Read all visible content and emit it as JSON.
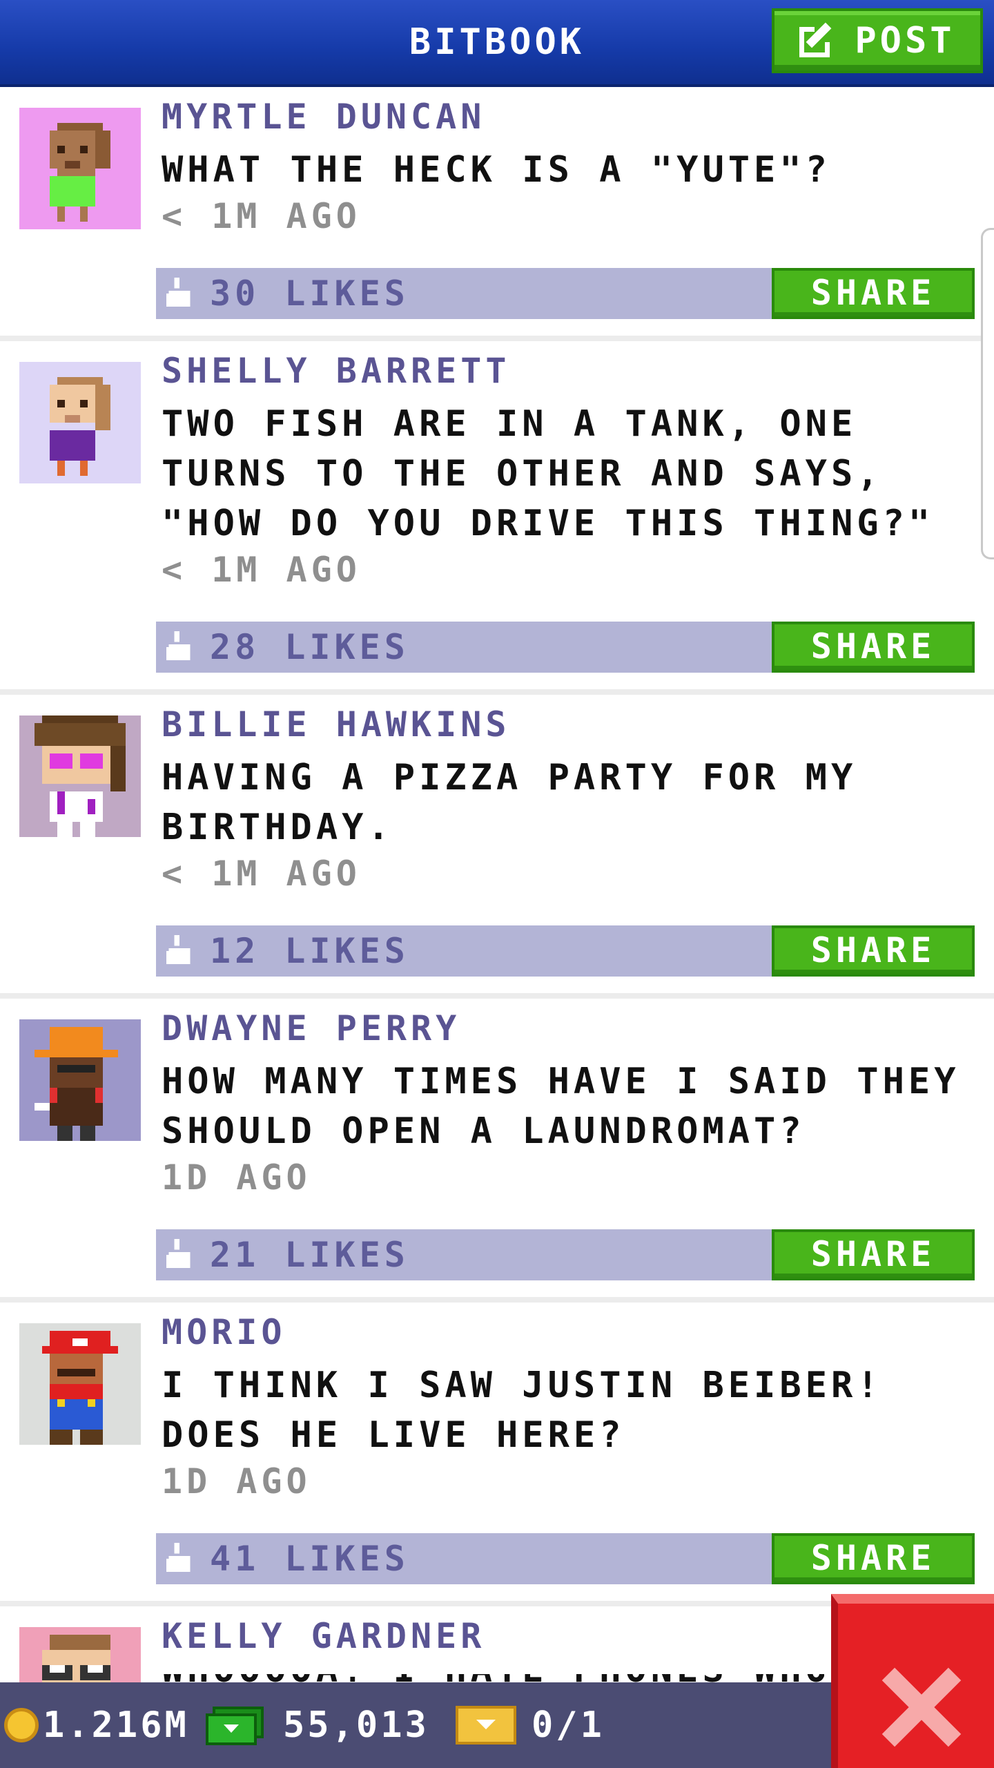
{
  "header": {
    "title": "BITBOOK",
    "post_label": "POST"
  },
  "posts": [
    {
      "author": "MYRTLE DUNCAN",
      "message": "WHAT THE HECK IS A \"YUTE\"?",
      "time": "< 1M AGO",
      "likes": "30 LIKES",
      "share": "SHARE",
      "avatar_bg": "#ee9af0",
      "skin": "#a9764f",
      "hair": "#8a5a34",
      "shirt": "#66ee44"
    },
    {
      "author": "SHELLY BARRETT",
      "message": "TWO FISH ARE IN A TANK, ONE TURNS TO THE OTHER AND SAYS, \"HOW DO YOU DRIVE THIS THING?\"",
      "time": "< 1M AGO",
      "likes": "28 LIKES",
      "share": "SHARE",
      "avatar_bg": "#ddd6f7",
      "skin": "#f0c8a0",
      "hair": "#b88454",
      "shirt": "#6a2aa0"
    },
    {
      "author": "BILLIE HAWKINS",
      "message": "HAVING A PIZZA PARTY FOR MY BIRTHDAY.",
      "time": "< 1M AGO",
      "likes": "12 LIKES",
      "share": "SHARE",
      "avatar_bg": "#c0a8c4",
      "skin": "#f0c8a0",
      "hair": "#5a3a1c",
      "shirt": "#ffffff"
    },
    {
      "author": "DWAYNE PERRY",
      "message": "HOW MANY TIMES HAVE I SAID THEY SHOULD OPEN A LAUNDROMAT?",
      "time": "1D AGO",
      "likes": "21 LIKES",
      "share": "SHARE",
      "avatar_bg": "#9c97c9",
      "skin": "#6a3e24",
      "hair": "#f28a1e",
      "shirt": "#4a2a18"
    },
    {
      "author": "MORIO",
      "message": "I THINK I SAW JUSTIN BEIBER! DOES HE LIVE HERE?",
      "time": "1D AGO",
      "likes": "41 LIKES",
      "share": "SHARE",
      "avatar_bg": "#dcdedc",
      "skin": "#b8683c",
      "hair": "#e02020",
      "shirt": "#2a5ad4"
    },
    {
      "author": "KELLY GARDNER",
      "message": "WHOOOOA! I HATE PHONES WHO DO",
      "avatar_bg": "#f0a0b8",
      "skin": "#f0c8a0",
      "hair": "#9a6a40",
      "shirt": "#333333"
    }
  ],
  "bottom_bar": {
    "coins": "1.216M",
    "bux": "55,013",
    "tickets": "0/1"
  },
  "colors": {
    "accent_green": "#49b51b",
    "header_blue": "#153aa8",
    "likes_bar": "#b3b4d6",
    "author_purple": "#5a5493",
    "close_red": "#e52025"
  }
}
